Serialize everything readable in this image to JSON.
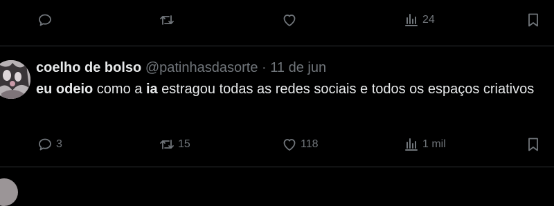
{
  "previous_post": {
    "actions": {
      "reply_count": "",
      "repost_count": "",
      "like_count": "",
      "views_count": "24"
    }
  },
  "post": {
    "display_name": "coelho de bolso",
    "handle": "@patinhasdasorte",
    "separator": "·",
    "date": "11 de jun",
    "text": {
      "part1": "eu odeio",
      "part2": " como a ",
      "part3": "ia",
      "part4": " estragou todas as redes sociais e todos os espaços criativos"
    },
    "actions": {
      "reply_count": "3",
      "repost_count": "15",
      "like_count": "118",
      "views_count": "1 mil"
    }
  },
  "colors": {
    "background": "#000000",
    "text_primary": "#e7e9ea",
    "text_secondary": "#71767b",
    "divider": "#2f3336"
  },
  "icons": [
    "reply-icon",
    "repost-icon",
    "like-icon",
    "views-icon",
    "bookmark-icon"
  ]
}
